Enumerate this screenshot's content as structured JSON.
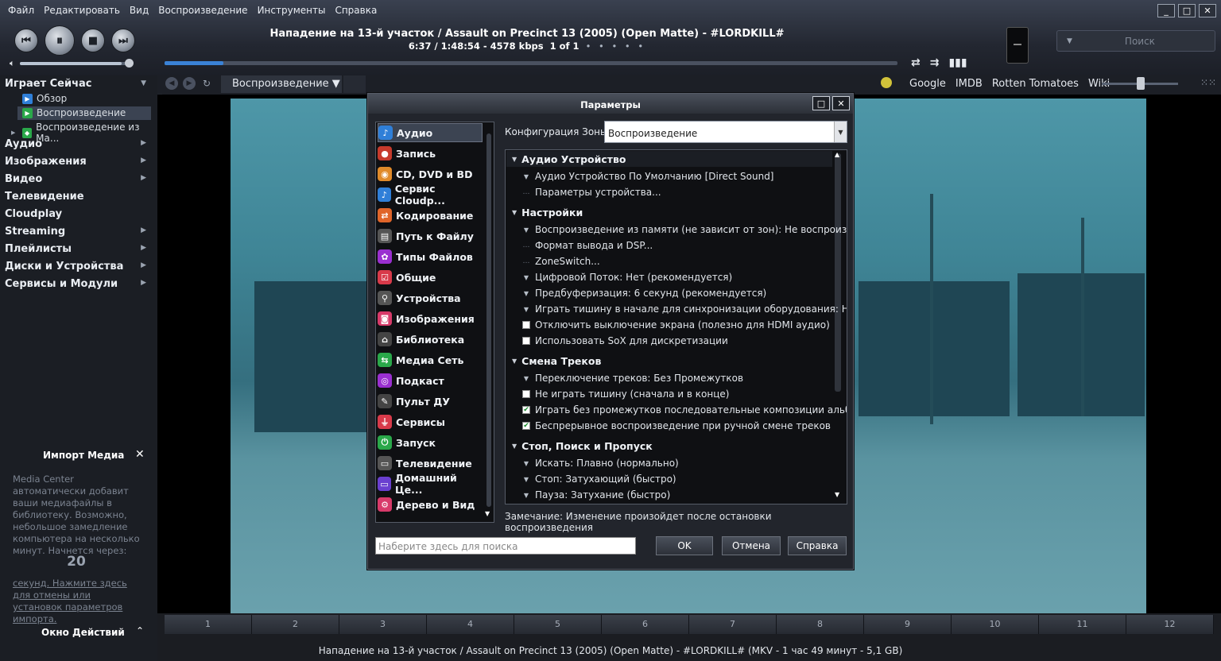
{
  "menu": [
    "Файл",
    "Редактировать",
    "Вид",
    "Воспроизведение",
    "Инструменты",
    "Справка"
  ],
  "window_buttons": [
    "_",
    "□",
    "✕"
  ],
  "transport": {
    "prev": "⏮",
    "pause": "⏸",
    "stop": "■",
    "next": "⏭"
  },
  "now_playing": {
    "title": "Нападение на 13-й участок / Assault on Precinct 13 (2005) (Open Matte) - #LORDKILL#",
    "time": "6:37 / 1:48:54 - 4578 kbps",
    "count": "1 of 1",
    "dots": "• • • • •",
    "progress_fraction": 0.08,
    "volume_fraction": 0.92
  },
  "search": {
    "placeholder": "Поиск"
  },
  "view": {
    "tab_label": "Воспроизведение ▼"
  },
  "links": [
    "Google",
    "IMDB",
    "Rotten Tomatoes",
    "Wiki"
  ],
  "sidebar": {
    "now_playing_header": "Играет Сейчас",
    "sub": [
      {
        "label": "Обзор",
        "color": "#2f7fd8"
      },
      {
        "label": "Воспроизведение",
        "color": "#2aa84a"
      },
      {
        "label": "Воспроизведение из Ma...",
        "color": "#2aa84a"
      }
    ],
    "items": [
      "Аудио",
      "Изображения",
      "Видео",
      "Телевидение",
      "Cloudplay",
      "Streaming",
      "Плейлисты",
      "Диски и Устройства",
      "Сервисы и Модули"
    ],
    "import": {
      "title": "Импорт Медиа",
      "text": "Media Center автоматически добавит ваши медиафайлы в библиотеку. Возможно, небольшое замедление компьютера на несколько минут. Начнется через:",
      "count": "20",
      "link": "секунд. Нажмите здесь для отмены или установок параметров импорта."
    },
    "actions_title": "Окно Действий"
  },
  "chapters": [
    "1",
    "2",
    "3",
    "4",
    "5",
    "6",
    "7",
    "8",
    "9",
    "10",
    "11",
    "12"
  ],
  "status": "Нападение на 13-й участок / Assault on Precinct 13 (2005) (Open Matte) - #LORDKILL# (MKV - 1 час 49 минут - 5,1 GB)",
  "dialog": {
    "title": "Параметры",
    "categories": [
      {
        "label": "Аудио",
        "icon": "♪",
        "color": "#2f7fd8"
      },
      {
        "label": "Запись",
        "icon": "●",
        "color": "#c73a2c"
      },
      {
        "label": "CD, DVD и BD",
        "icon": "◉",
        "color": "#e08a2a"
      },
      {
        "label": "Сервис Cloudp...",
        "icon": "♪",
        "color": "#2f7fd8"
      },
      {
        "label": "Кодирование",
        "icon": "⇄",
        "color": "#e0652a"
      },
      {
        "label": "Путь к Файлу",
        "icon": "▤",
        "color": "#555"
      },
      {
        "label": "Типы Файлов",
        "icon": "✿",
        "color": "#9a2fd0"
      },
      {
        "label": "Общие",
        "icon": "☑",
        "color": "#d83a4a"
      },
      {
        "label": "Устройства",
        "icon": "⚲",
        "color": "#555"
      },
      {
        "label": "Изображения",
        "icon": "◙",
        "color": "#d83a6a"
      },
      {
        "label": "Библиотека",
        "icon": "⌂",
        "color": "#444"
      },
      {
        "label": "Медиа Сеть",
        "icon": "⇆",
        "color": "#2aa84a"
      },
      {
        "label": "Подкаст",
        "icon": "◎",
        "color": "#9a2fd0"
      },
      {
        "label": "Пульт ДУ",
        "icon": "✎",
        "color": "#444"
      },
      {
        "label": "Сервисы",
        "icon": "⏚",
        "color": "#d83a4a"
      },
      {
        "label": "Запуск",
        "icon": "⏻",
        "color": "#2aa84a"
      },
      {
        "label": "Телевидение",
        "icon": "▭",
        "color": "#555"
      },
      {
        "label": "Домашний Це...",
        "icon": "▭",
        "color": "#6a3fd0"
      },
      {
        "label": "Дерево и Вид",
        "icon": "⚙",
        "color": "#d83a6a"
      }
    ],
    "zone_label": "Конфигурация Зоны:",
    "zone_value": "Воспроизведение",
    "sections": [
      {
        "title": "Аудио Устройство",
        "items": [
          {
            "mark": "tri",
            "label": "Аудио Устройство По Умолчанию [Direct Sound]"
          },
          {
            "mark": "dots",
            "label": "Параметры устройства..."
          }
        ]
      },
      {
        "title": "Настройки",
        "items": [
          {
            "mark": "tri",
            "label": "Воспроизведение из памяти (не зависит от зон): Не воспроизвод..."
          },
          {
            "mark": "dots",
            "label": "Формат вывода и DSP..."
          },
          {
            "mark": "dots",
            "label": "ZoneSwitch..."
          },
          {
            "mark": "tri",
            "label": "Цифровой Поток: Нет (рекомендуется)"
          },
          {
            "mark": "tri",
            "label": "Предбуферизация: 6 секунд (рекомендуется)"
          },
          {
            "mark": "tri",
            "label": "Играть тишину в начале для синхронизации оборудования: Нет"
          },
          {
            "mark": "cb",
            "checked": false,
            "label": "Отключить выключение экрана (полезно для HDMI аудио)"
          },
          {
            "mark": "cb",
            "checked": false,
            "label": "Использовать SoX для дискретизации"
          }
        ]
      },
      {
        "title": "Смена Треков",
        "items": [
          {
            "mark": "tri",
            "label": "Переключение треков: Без Промежутков"
          },
          {
            "mark": "cb",
            "checked": false,
            "label": "Не играть тишину (сначала и в конце)"
          },
          {
            "mark": "cb",
            "checked": true,
            "label": "Играть без промежутков последовательные композиции альбома"
          },
          {
            "mark": "cb",
            "checked": true,
            "label": "Беспрерывное воспроизведение при ручной смене треков"
          }
        ]
      },
      {
        "title": "Стоп, Поиск и Пропуск",
        "items": [
          {
            "mark": "tri",
            "label": "Искать: Плавно (нормально)"
          },
          {
            "mark": "tri",
            "label": "Стоп: Затухающий (быстро)"
          },
          {
            "mark": "tri",
            "label": "Пауза: Затухание (быстро)"
          }
        ]
      }
    ],
    "note": "Замечание: Изменение произойдет после остановки воспроизведения",
    "search_placeholder": "Наберите здесь для поиска",
    "ok": "OK",
    "cancel": "Отмена",
    "help": "Справка"
  }
}
